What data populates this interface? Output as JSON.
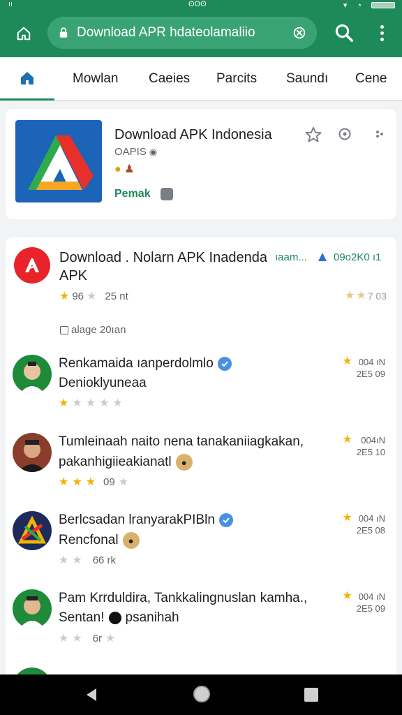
{
  "status_bar": {
    "left": "ıı",
    "center": "ʘʘʘ"
  },
  "address_bar": {
    "url": "Download APR hdateolamaliio"
  },
  "tabs": [
    {
      "label": "Mowlan"
    },
    {
      "label": "Caeies"
    },
    {
      "label": "Parcits"
    },
    {
      "label": "Saundı"
    },
    {
      "label": "Cene"
    }
  ],
  "hero": {
    "title": "Download APK Indonesia",
    "subtitle": "OAPIS",
    "tag": "Pemak"
  },
  "top_result": {
    "title": "Download . Nolarn APK Inadenda",
    "title_line2": "APK",
    "link": "ıaam...",
    "size": "09o2K0 ı1",
    "rating_text": "96",
    "reviews": "25 nt",
    "right_rating": "7 03"
  },
  "section": {
    "label": "alage 20ıan"
  },
  "reviews": [
    {
      "line1": "Renkamaida ıanperdolmlo",
      "line2": "Denioklyuneaa",
      "stars": 1,
      "count": "",
      "date": "004 ıN",
      "date2": "2E5 09",
      "verified": true,
      "badge": false
    },
    {
      "line1": "Tumleinaah naito nena tanakaniiagkakan,",
      "line2": "pakanhigiieakianatl",
      "stars": 3,
      "count": "09",
      "date": "004ıN",
      "date2": "2E5 10",
      "verified": false,
      "badge": true
    },
    {
      "line1": "Berlcsadan lranyarakPIBln",
      "line2": "Rencfonal",
      "stars": 0,
      "count": "66 rk",
      "date": "004 ıN",
      "date2": "2E5 08",
      "verified": true,
      "badge": true
    },
    {
      "line1": "Pam Krrduldira, Tankkalingnuslan",
      "line1_tail": "kamha.,",
      "line2": "Sentan!",
      "line2_tail": "psanihah",
      "stars": 0,
      "count": "6r",
      "date": "004 ıN",
      "date2": "2E5 09",
      "verified": false,
      "badge": false
    }
  ],
  "colors": {
    "brand": "#1e8a5a",
    "star": "#f2b400"
  }
}
